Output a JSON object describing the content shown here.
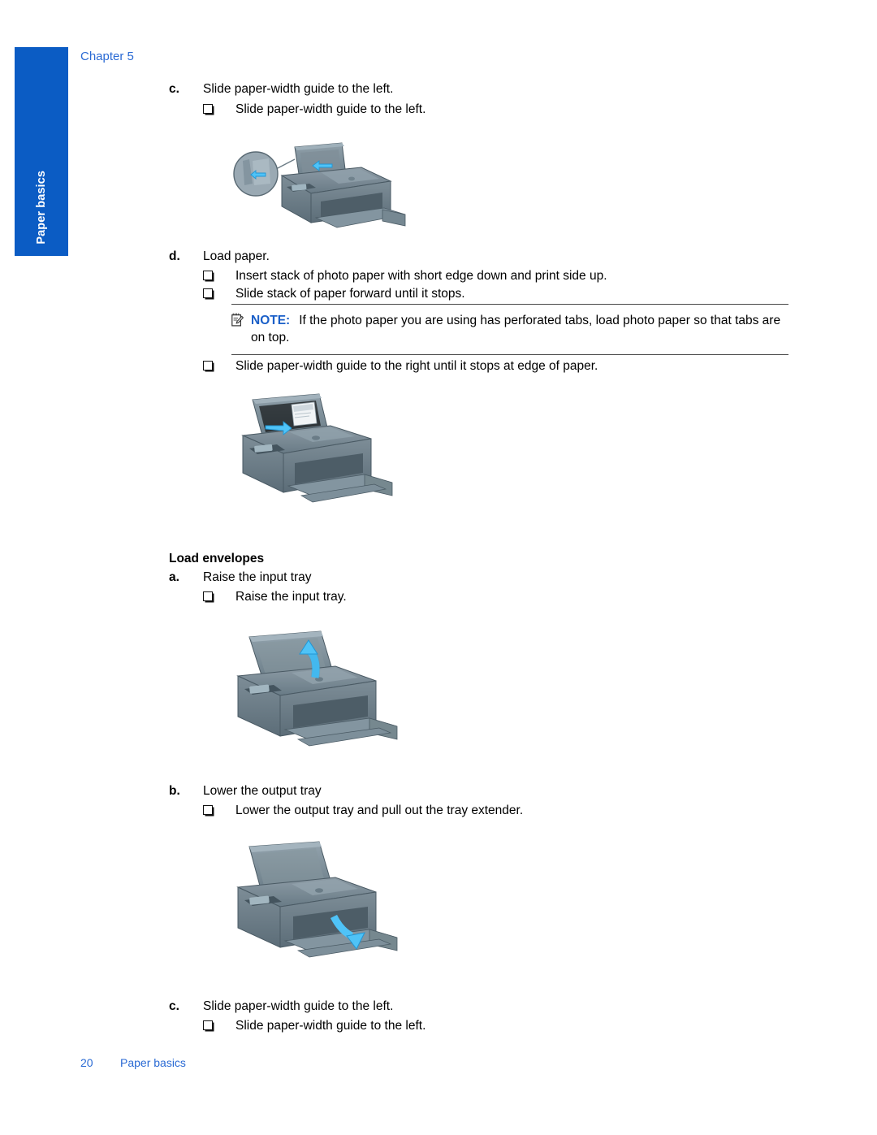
{
  "page": {
    "chapter_head": "Chapter 5",
    "side_tab_label": "Paper basics",
    "tab_color": "#0b5cc4",
    "link_color": "#2a6ad4"
  },
  "steps": {
    "c1": {
      "marker": "c.",
      "text": "Slide paper-width guide to the left."
    },
    "c1_bullet": "Slide paper-width guide to the left.",
    "d": {
      "marker": "d.",
      "text": "Load paper."
    },
    "d_bullet_1": "Insert stack of photo paper with short edge down and print side up.",
    "d_bullet_2": "Slide stack of paper forward until it stops.",
    "d_bullet_3": "Slide paper-width guide to the right until it stops at edge of paper.",
    "load_envelopes_heading": "Load envelopes",
    "a": {
      "marker": "a.",
      "text": "Raise the input tray"
    },
    "a_bullet": "Raise the input tray.",
    "b": {
      "marker": "b.",
      "text": "Lower the output tray"
    },
    "b_bullet": "Lower the output tray and pull out the tray extender.",
    "c2": {
      "marker": "c.",
      "text": "Slide paper-width guide to the left."
    },
    "c2_bullet": "Slide paper-width guide to the left."
  },
  "note": {
    "label": "NOTE:",
    "text": "If the photo paper you are using has perforated tabs, load photo paper so that tabs are on top.",
    "label_color": "#1a5fc8",
    "icon": "note-pencil-icon"
  },
  "figures": {
    "fig1": {
      "caption_ref": "Slide paper-width guide to the left",
      "arrow": "left-arrow",
      "has_magnifier": true
    },
    "fig2": {
      "caption_ref": "Load photo paper and slide guide right",
      "arrow": "right-arrow",
      "has_magnifier": false
    },
    "fig3": {
      "caption_ref": "Raise the input tray",
      "arrow": "curved-up-arrow",
      "has_magnifier": false
    },
    "fig4": {
      "caption_ref": "Lower the output tray",
      "arrow": "curved-down-arrow",
      "has_magnifier": false
    }
  },
  "footer": {
    "page_number": "20",
    "section": "Paper basics"
  }
}
